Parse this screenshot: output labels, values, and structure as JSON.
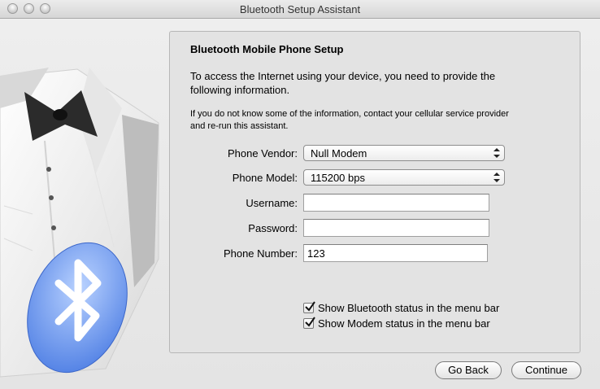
{
  "window": {
    "title": "Bluetooth Setup Assistant"
  },
  "panel": {
    "heading": "Bluetooth Mobile Phone Setup",
    "intro_line1": "To access the Internet using your device, you need to provide the",
    "intro_line2": "following information.",
    "note_line1": "If you do not know some of the information, contact your cellular service provider",
    "note_line2": "and re-run this assistant."
  },
  "form": {
    "vendor_label": "Phone Vendor:",
    "vendor_value": "Null Modem",
    "model_label": "Phone Model:",
    "model_value": "115200 bps",
    "username_label": "Username:",
    "username_value": "",
    "password_label": "Password:",
    "password_value": "",
    "phone_label": "Phone Number:",
    "phone_value": "123"
  },
  "options": {
    "bluetooth_status": {
      "label": "Show Bluetooth status in the menu bar",
      "checked": true
    },
    "modem_status": {
      "label": "Show Modem status in the menu bar",
      "checked": true
    }
  },
  "buttons": {
    "back": "Go Back",
    "continue": "Continue"
  },
  "icons": {
    "left_art": "tuxedo-shirt-with-bluetooth-logo",
    "window_controls": "traffic-light-buttons"
  }
}
